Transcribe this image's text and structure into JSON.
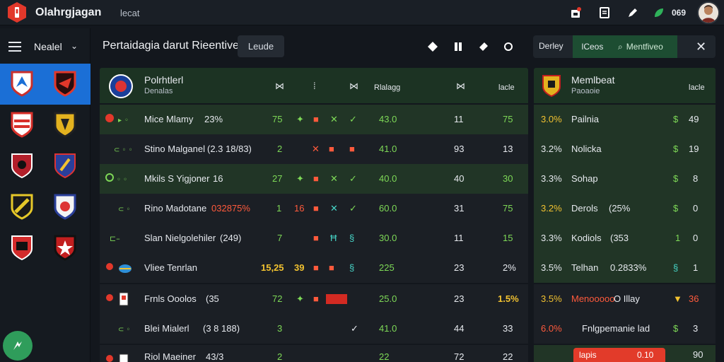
{
  "app": {
    "title": "Olahrgjagan",
    "search_label": "lecat",
    "status_count": "069"
  },
  "colors": {
    "accent_blue": "#1b6fd6",
    "accent_green": "#2f9d5b",
    "row_green": "#213526",
    "logo_red": "#e2382b"
  },
  "sidebar": {
    "menu_label": "Nealel",
    "fab_icon": "sports-icon",
    "teams": [
      {
        "left": "red-shield-team-icon",
        "right": "dark-red-team-icon",
        "active": true
      },
      {
        "left": "striped-red-team-icon",
        "right": "gold-black-team-icon"
      },
      {
        "left": "crimson-crest-team-icon",
        "right": "blue-crest-team-icon"
      },
      {
        "left": "yellow-black-team-icon",
        "right": "blue-white-team-icon"
      },
      {
        "left": "red-black-shield-team-icon",
        "right": "black-star-team-icon"
      }
    ]
  },
  "header": {
    "title": "Pertaidagia darut Rieentive",
    "button_label": "Leude"
  },
  "right_header": {
    "tab1": "Derley",
    "tab2": "lCeos",
    "search": "Mentfiveo"
  },
  "table": {
    "head": {
      "title": "Polrhtlerl",
      "subtitle": "Denalas",
      "col3": "Rlalagg",
      "col5": "lacle"
    },
    "rows": [
      {
        "name": "Mice Mlamy",
        "extra": "23%",
        "v1": "75",
        "v2": "43.0",
        "v3": "11",
        "v4": "75",
        "style": "g"
      },
      {
        "name": "Stino Malganel",
        "extra": "(2.3 18/83)",
        "v1": "2",
        "v2": "41.0",
        "v3": "93",
        "v4": "13",
        "style": "d"
      },
      {
        "name": "Mkils S Yigjoner",
        "extra": "16",
        "v1": "27",
        "v2": "40.0",
        "v3": "40",
        "v4": "30",
        "style": "g"
      },
      {
        "name": "Rino Madotane",
        "extra": "032875%",
        "v1": "1",
        "v1b": "16",
        "v2": "60.0",
        "v3": "31",
        "v4": "75",
        "style": "d"
      },
      {
        "name": "Slan Nielgolehiler",
        "extra": "(249)",
        "v1": "7",
        "v2": "30.0",
        "v3": "11",
        "v4": "15",
        "style": "d"
      },
      {
        "name": "Vliee Tenrlan",
        "extra": "",
        "v1": "15,25",
        "v1b": "39",
        "v2": "225",
        "v3": "23",
        "v4": "2%",
        "style": "d"
      },
      {
        "name": "Frnls Ooolos",
        "extra": "(35",
        "v1": "72",
        "v2": "25.0",
        "v3": "23",
        "v4": "1.5%",
        "style": "d"
      },
      {
        "name": "Blei Mialerl",
        "extra": "(3 8 188)",
        "v1": "3",
        "v2": "41.0",
        "v3": "44",
        "v4": "33",
        "style": "d"
      },
      {
        "name": "Riol Maeiner",
        "extra": "43/3",
        "v1": "2",
        "v2": "22",
        "v3": "72",
        "v4": "22",
        "style": "d"
      }
    ]
  },
  "rtable": {
    "head": {
      "title": "Memlbeat",
      "subtitle": "Paoaoie",
      "col": "lacle"
    },
    "rows": [
      {
        "pct": "3.0%",
        "name": "Pailnia",
        "extra": "",
        "val": "49"
      },
      {
        "pct": "3.2%",
        "name": "Nolicka",
        "extra": "",
        "val": "19"
      },
      {
        "pct": "3.3%",
        "name": "Sohap",
        "extra": "",
        "val": "8"
      },
      {
        "pct": "3.2%",
        "name": "Derols",
        "extra": "(25%",
        "val": "0"
      },
      {
        "pct": "3.3%",
        "name": "Kodiols",
        "extra": "(353",
        "val": "1"
      },
      {
        "pct": "3.5%",
        "name": "Telhan",
        "extra": "0.2833%",
        "val": "1"
      },
      {
        "pct": "3.5%",
        "name": "Menooooo",
        "extra": "O Illay",
        "val": "36"
      },
      {
        "pct": "6.0%",
        "name": "Fnlgpemanie lad",
        "extra": "",
        "val": "3"
      },
      {
        "pct": "",
        "name": "",
        "extra": "",
        "val": "90"
      }
    ]
  },
  "toast": {
    "label": "lapis",
    "value": "0.10"
  }
}
